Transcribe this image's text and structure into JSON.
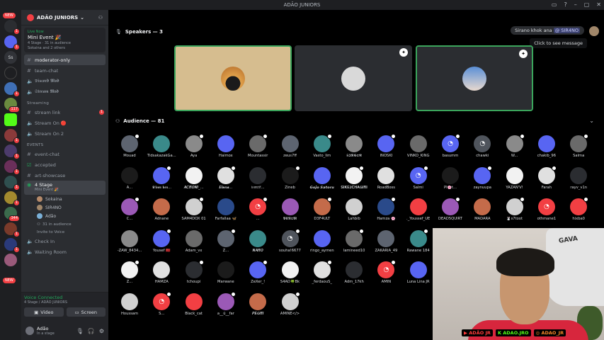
{
  "window": {
    "title": "ADÃO JUNIORS"
  },
  "rail": {
    "new_label": "NEW",
    "badges": [
      "1",
      "1",
      "1",
      "117",
      "1",
      "1",
      "1",
      "1",
      "1",
      "344",
      "1",
      "1"
    ],
    "dm_label": "Ss"
  },
  "server": {
    "name": "ADÃO JUNIORS"
  },
  "live": {
    "status": "Live Now",
    "event": "Mini Event 🎉",
    "meta": "4 Stage · 31 in audience",
    "participants": "Sokaina and 2 others"
  },
  "channels_top": [
    {
      "name": "moderator-only",
      "active": true
    },
    {
      "name": "team-chat"
    },
    {
      "name": "𝕯𝖎𝖘𝖈𝖔𝖗𝖉 𝕸𝖔𝖉"
    },
    {
      "name": "𝕾𝖙𝖗𝖊𝖆𝖒 𝕸𝖔𝖉"
    }
  ],
  "cat_streaming": "Streaming",
  "channels_streaming": [
    {
      "name": "stream link",
      "badge": "1"
    },
    {
      "name": "Stream On 🔴"
    },
    {
      "name": "Stream On 2"
    }
  ],
  "cat_events": "EVENTS",
  "channels_events": [
    {
      "name": "event-chat"
    },
    {
      "name": "accepted"
    },
    {
      "name": "art-showcase"
    }
  ],
  "stage_channel": {
    "name": "4 Stage",
    "sub": "Mini Event 🎉"
  },
  "voice_users": [
    "Sokaina",
    "SIR4NO",
    "Adão"
  ],
  "audience_line": "31 in audience",
  "invite_label": "Invite to Voice",
  "channels_bottom": [
    {
      "name": "Check In"
    },
    {
      "name": "Waiting Room"
    }
  ],
  "voice_panel": {
    "status": "Voice Connected",
    "channel": "4 Stage / ADÃO JUNIORS",
    "video_label": "Video",
    "screen_label": "Screen"
  },
  "user_panel": {
    "name": "Adão",
    "status": "In a stage"
  },
  "speakers": {
    "label": "Speakers — 3"
  },
  "audience": {
    "label": "Audience — 81"
  },
  "chip": {
    "prefix": "Sirano khok ana",
    "user": "@ SIR4NO"
  },
  "tooltip": "Click to see message",
  "audience_members": [
    [
      "Mouad",
      "TidsakazakGa...",
      "Aya",
      "Haimox",
      "Mountassir",
      "zeus7ff",
      "Vasto_lim",
      "𝕾𝕴𝕹𝕲𝕺𝕽",
      "INOSKI",
      "VINKO_KING",
      "basumm",
      "chawki",
      "W...",
      "chakib_96",
      "Salma"
    ],
    [
      "A...",
      "♛𝖑𝖊𝖔𝖓 𝖐𝖊𝖓...",
      "𝑨𝑪𝑹𝑶𝑵𝑰_...",
      "𝑬𝒍𝒆𝒏𝒂...",
      "𝔦𝔪𝔬𝔯𝔱𝔦𝔣...",
      "Zineb",
      "𝙂𝙤𝙟𝙤 𝙎𝙖𝙩𝙤𝙧𝙪",
      "𝐒𝐈𝐊𝐄𝟐𝐂𝐇𝐀𝐆𝐈𝐑𝐈",
      "RoadBoss",
      "Salmi",
      "Pl🌸t...",
      "zaynuupa",
      "YAZAN'V!",
      "Farah",
      "rayv_v1n"
    ],
    [
      "C...",
      "Adnane",
      "SAM4DOX 01",
      "Farfallaa 🦋",
      "...",
      "𝖁𝕰𝕹𝕺𝕸",
      "D3F4ULT",
      "Lahbib",
      "Hamza 🌸",
      "._Youssef_UE",
      "DEAD5QUIRT",
      "MADARA",
      "🐰s7toot",
      "othmane1",
      "hixba0"
    ],
    [
      "-ZAW_8434...",
      "Yousef 🇲🇦",
      "Adam_vx",
      "Z...",
      "𝑵𝑨𝑹𝑶",
      "souha!6677",
      "ringo_aymen",
      "lamineed10",
      "ZAKARIA_49",
      "Rawane 184"
    ],
    [
      "Z...",
      "HAMZA",
      "tchoupi",
      "Marwane",
      "ZeXer_!",
      "S4AD🍀Bk",
      "_ferdaouS_",
      "Adm_17kh",
      "AMIN",
      "Luna Lina JR"
    ],
    [
      "Houssam",
      "S...",
      "Black_cat",
      "a__ü__far",
      "𝑷𝑬𝑮𝑹𝑰",
      "AMINE</>"
    ]
  ],
  "stream_handles": {
    "youtube": "ADÃO JR",
    "kick": "ADAO.JRO",
    "instagram": "ADAO_JR"
  },
  "webcam_text": "GAVA",
  "colors": {
    "accent": "#5865f2",
    "online": "#23a55a",
    "alert": "#f23f43",
    "speaker_border": "#3ba55c"
  }
}
